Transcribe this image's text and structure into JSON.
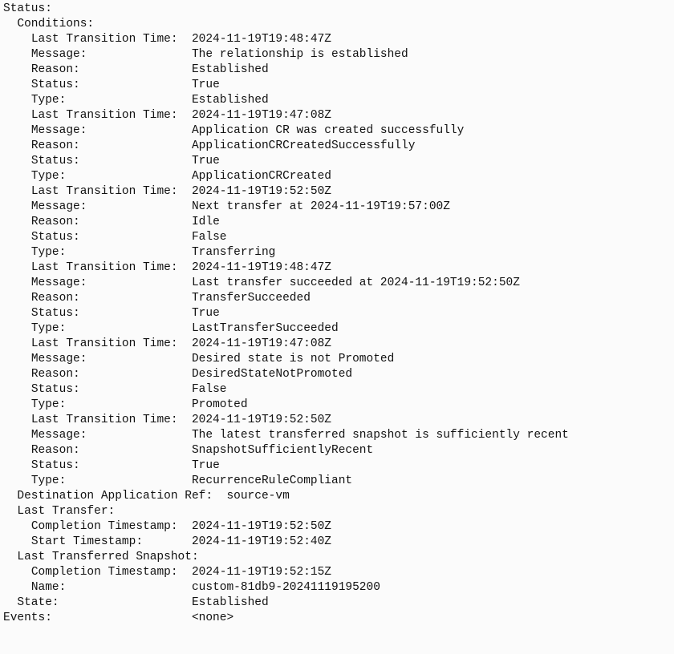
{
  "labels": {
    "status": "Status:",
    "conditions": "Conditions:",
    "last_transition_time": "Last Transition Time:",
    "message": "Message:",
    "reason": "Reason:",
    "status_field": "Status:",
    "type": "Type:",
    "destination_application_ref": "Destination Application Ref:",
    "last_transfer": "Last Transfer:",
    "completion_timestamp": "Completion Timestamp:",
    "start_timestamp": "Start Timestamp:",
    "last_transferred_snapshot": "Last Transferred Snapshot:",
    "name": "Name:",
    "state": "State:",
    "events": "Events:"
  },
  "status": {
    "conditions": [
      {
        "last_transition_time": "2024-11-19T19:48:47Z",
        "message": "The relationship is established",
        "reason": "Established",
        "status": "True",
        "type": "Established"
      },
      {
        "last_transition_time": "2024-11-19T19:47:08Z",
        "message": "Application CR was created successfully",
        "reason": "ApplicationCRCreatedSuccessfully",
        "status": "True",
        "type": "ApplicationCRCreated"
      },
      {
        "last_transition_time": "2024-11-19T19:52:50Z",
        "message": "Next transfer at 2024-11-19T19:57:00Z",
        "reason": "Idle",
        "status": "False",
        "type": "Transferring"
      },
      {
        "last_transition_time": "2024-11-19T19:48:47Z",
        "message": "Last transfer succeeded at 2024-11-19T19:52:50Z",
        "reason": "TransferSucceeded",
        "status": "True",
        "type": "LastTransferSucceeded"
      },
      {
        "last_transition_time": "2024-11-19T19:47:08Z",
        "message": "Desired state is not Promoted",
        "reason": "DesiredStateNotPromoted",
        "status": "False",
        "type": "Promoted"
      },
      {
        "last_transition_time": "2024-11-19T19:52:50Z",
        "message": "The latest transferred snapshot is sufficiently recent",
        "reason": "SnapshotSufficientlyRecent",
        "status": "True",
        "type": "RecurrenceRuleCompliant"
      }
    ],
    "destination_application_ref": "source-vm",
    "last_transfer": {
      "completion_timestamp": "2024-11-19T19:52:50Z",
      "start_timestamp": "2024-11-19T19:52:40Z"
    },
    "last_transferred_snapshot": {
      "completion_timestamp": "2024-11-19T19:52:15Z",
      "name": "custom-81db9-20241119195200"
    },
    "state": "Established"
  },
  "events": "<none>"
}
